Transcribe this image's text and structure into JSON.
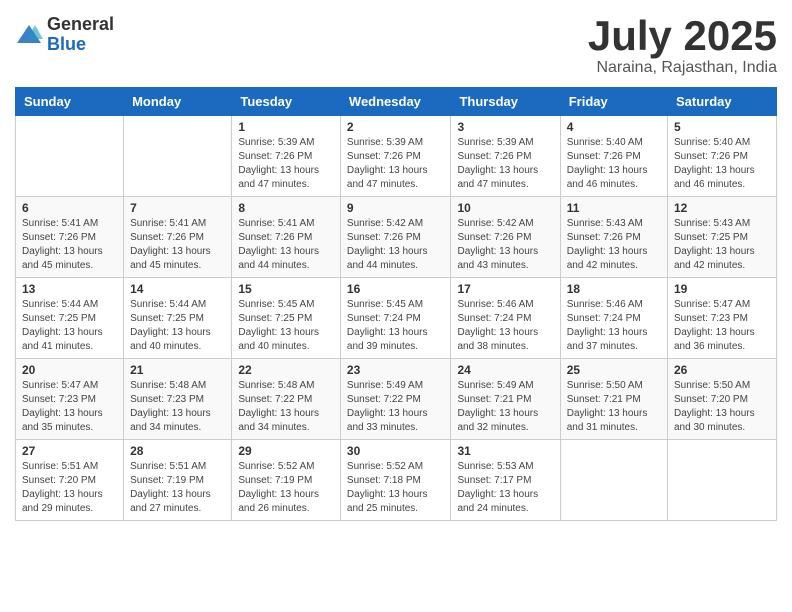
{
  "logo": {
    "general": "General",
    "blue": "Blue"
  },
  "title": {
    "month_year": "July 2025",
    "location": "Naraina, Rajasthan, India"
  },
  "days_of_week": [
    "Sunday",
    "Monday",
    "Tuesday",
    "Wednesday",
    "Thursday",
    "Friday",
    "Saturday"
  ],
  "weeks": [
    [
      {
        "day": "",
        "sunrise": "",
        "sunset": "",
        "daylight": ""
      },
      {
        "day": "",
        "sunrise": "",
        "sunset": "",
        "daylight": ""
      },
      {
        "day": "1",
        "sunrise": "Sunrise: 5:39 AM",
        "sunset": "Sunset: 7:26 PM",
        "daylight": "Daylight: 13 hours and 47 minutes."
      },
      {
        "day": "2",
        "sunrise": "Sunrise: 5:39 AM",
        "sunset": "Sunset: 7:26 PM",
        "daylight": "Daylight: 13 hours and 47 minutes."
      },
      {
        "day": "3",
        "sunrise": "Sunrise: 5:39 AM",
        "sunset": "Sunset: 7:26 PM",
        "daylight": "Daylight: 13 hours and 47 minutes."
      },
      {
        "day": "4",
        "sunrise": "Sunrise: 5:40 AM",
        "sunset": "Sunset: 7:26 PM",
        "daylight": "Daylight: 13 hours and 46 minutes."
      },
      {
        "day": "5",
        "sunrise": "Sunrise: 5:40 AM",
        "sunset": "Sunset: 7:26 PM",
        "daylight": "Daylight: 13 hours and 46 minutes."
      }
    ],
    [
      {
        "day": "6",
        "sunrise": "Sunrise: 5:41 AM",
        "sunset": "Sunset: 7:26 PM",
        "daylight": "Daylight: 13 hours and 45 minutes."
      },
      {
        "day": "7",
        "sunrise": "Sunrise: 5:41 AM",
        "sunset": "Sunset: 7:26 PM",
        "daylight": "Daylight: 13 hours and 45 minutes."
      },
      {
        "day": "8",
        "sunrise": "Sunrise: 5:41 AM",
        "sunset": "Sunset: 7:26 PM",
        "daylight": "Daylight: 13 hours and 44 minutes."
      },
      {
        "day": "9",
        "sunrise": "Sunrise: 5:42 AM",
        "sunset": "Sunset: 7:26 PM",
        "daylight": "Daylight: 13 hours and 44 minutes."
      },
      {
        "day": "10",
        "sunrise": "Sunrise: 5:42 AM",
        "sunset": "Sunset: 7:26 PM",
        "daylight": "Daylight: 13 hours and 43 minutes."
      },
      {
        "day": "11",
        "sunrise": "Sunrise: 5:43 AM",
        "sunset": "Sunset: 7:26 PM",
        "daylight": "Daylight: 13 hours and 42 minutes."
      },
      {
        "day": "12",
        "sunrise": "Sunrise: 5:43 AM",
        "sunset": "Sunset: 7:25 PM",
        "daylight": "Daylight: 13 hours and 42 minutes."
      }
    ],
    [
      {
        "day": "13",
        "sunrise": "Sunrise: 5:44 AM",
        "sunset": "Sunset: 7:25 PM",
        "daylight": "Daylight: 13 hours and 41 minutes."
      },
      {
        "day": "14",
        "sunrise": "Sunrise: 5:44 AM",
        "sunset": "Sunset: 7:25 PM",
        "daylight": "Daylight: 13 hours and 40 minutes."
      },
      {
        "day": "15",
        "sunrise": "Sunrise: 5:45 AM",
        "sunset": "Sunset: 7:25 PM",
        "daylight": "Daylight: 13 hours and 40 minutes."
      },
      {
        "day": "16",
        "sunrise": "Sunrise: 5:45 AM",
        "sunset": "Sunset: 7:24 PM",
        "daylight": "Daylight: 13 hours and 39 minutes."
      },
      {
        "day": "17",
        "sunrise": "Sunrise: 5:46 AM",
        "sunset": "Sunset: 7:24 PM",
        "daylight": "Daylight: 13 hours and 38 minutes."
      },
      {
        "day": "18",
        "sunrise": "Sunrise: 5:46 AM",
        "sunset": "Sunset: 7:24 PM",
        "daylight": "Daylight: 13 hours and 37 minutes."
      },
      {
        "day": "19",
        "sunrise": "Sunrise: 5:47 AM",
        "sunset": "Sunset: 7:23 PM",
        "daylight": "Daylight: 13 hours and 36 minutes."
      }
    ],
    [
      {
        "day": "20",
        "sunrise": "Sunrise: 5:47 AM",
        "sunset": "Sunset: 7:23 PM",
        "daylight": "Daylight: 13 hours and 35 minutes."
      },
      {
        "day": "21",
        "sunrise": "Sunrise: 5:48 AM",
        "sunset": "Sunset: 7:23 PM",
        "daylight": "Daylight: 13 hours and 34 minutes."
      },
      {
        "day": "22",
        "sunrise": "Sunrise: 5:48 AM",
        "sunset": "Sunset: 7:22 PM",
        "daylight": "Daylight: 13 hours and 34 minutes."
      },
      {
        "day": "23",
        "sunrise": "Sunrise: 5:49 AM",
        "sunset": "Sunset: 7:22 PM",
        "daylight": "Daylight: 13 hours and 33 minutes."
      },
      {
        "day": "24",
        "sunrise": "Sunrise: 5:49 AM",
        "sunset": "Sunset: 7:21 PM",
        "daylight": "Daylight: 13 hours and 32 minutes."
      },
      {
        "day": "25",
        "sunrise": "Sunrise: 5:50 AM",
        "sunset": "Sunset: 7:21 PM",
        "daylight": "Daylight: 13 hours and 31 minutes."
      },
      {
        "day": "26",
        "sunrise": "Sunrise: 5:50 AM",
        "sunset": "Sunset: 7:20 PM",
        "daylight": "Daylight: 13 hours and 30 minutes."
      }
    ],
    [
      {
        "day": "27",
        "sunrise": "Sunrise: 5:51 AM",
        "sunset": "Sunset: 7:20 PM",
        "daylight": "Daylight: 13 hours and 29 minutes."
      },
      {
        "day": "28",
        "sunrise": "Sunrise: 5:51 AM",
        "sunset": "Sunset: 7:19 PM",
        "daylight": "Daylight: 13 hours and 27 minutes."
      },
      {
        "day": "29",
        "sunrise": "Sunrise: 5:52 AM",
        "sunset": "Sunset: 7:19 PM",
        "daylight": "Daylight: 13 hours and 26 minutes."
      },
      {
        "day": "30",
        "sunrise": "Sunrise: 5:52 AM",
        "sunset": "Sunset: 7:18 PM",
        "daylight": "Daylight: 13 hours and 25 minutes."
      },
      {
        "day": "31",
        "sunrise": "Sunrise: 5:53 AM",
        "sunset": "Sunset: 7:17 PM",
        "daylight": "Daylight: 13 hours and 24 minutes."
      },
      {
        "day": "",
        "sunrise": "",
        "sunset": "",
        "daylight": ""
      },
      {
        "day": "",
        "sunrise": "",
        "sunset": "",
        "daylight": ""
      }
    ]
  ]
}
